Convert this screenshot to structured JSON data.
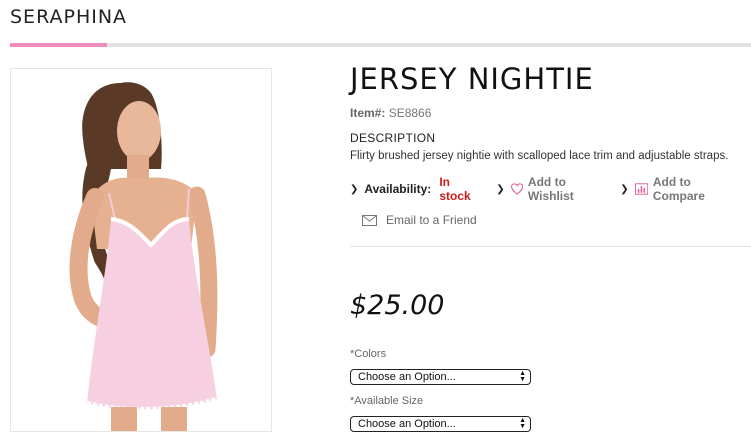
{
  "brand": "SERAPHINA",
  "product": {
    "title": "JERSEY NIGHTIE",
    "item_label": "Item#:",
    "item_number": "SE8866",
    "description_heading": "DESCRIPTION",
    "description": "Flirty brushed jersey nightie with scalloped lace trim and adjustable straps.",
    "price": "$25.00"
  },
  "actions": {
    "availability_label": "Availability:",
    "availability_value": "In stock",
    "wishlist": "Add to Wishlist",
    "compare": "Add to Compare",
    "email": "Email to a Friend"
  },
  "options": {
    "colors_label": "Colors",
    "colors_value": "Choose an Option...",
    "size_label": "Available Size",
    "size_value": "Choose an Option..."
  },
  "colors": {
    "accent_pink": "#f08bbd",
    "in_stock_red": "#d0191b"
  },
  "icons": [
    "chevron-right-icon",
    "heart-icon",
    "compare-chart-icon",
    "envelope-icon",
    "select-arrows-icon"
  ]
}
